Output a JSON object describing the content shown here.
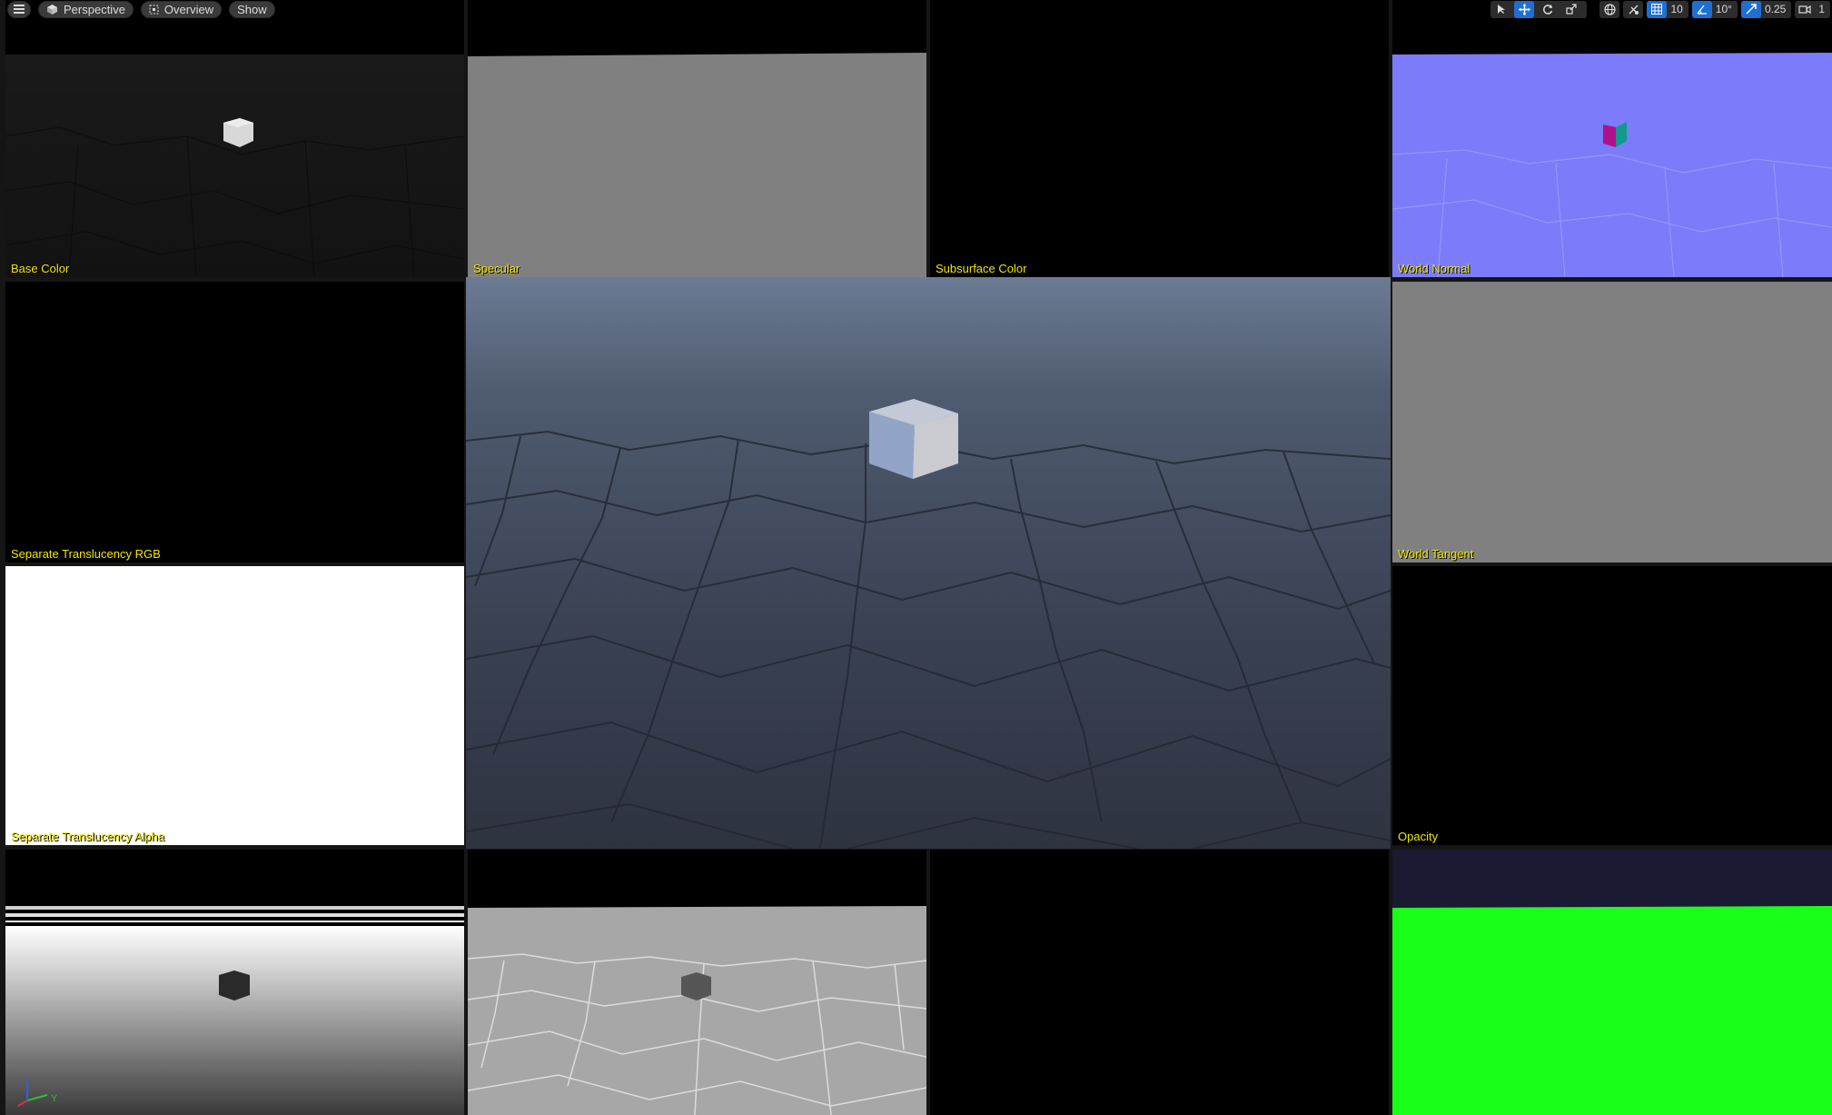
{
  "toolbar": {
    "menu_icon": "hamburger-icon",
    "perspective_label": "Perspective",
    "overview_label": "Overview",
    "show_label": "Show",
    "grid_snap_value": "10",
    "rotation_snap_value": "10°",
    "scale_snap_value": "0.25",
    "camera_speed_value": "1"
  },
  "panes": {
    "base_color": "Base Color",
    "specular": "Specular",
    "subsurface_color": "Subsurface Color",
    "world_normal": "World Normal",
    "separate_translucency_rgb": "Separate Translucency RGB",
    "world_tangent": "World Tangent",
    "separate_translucency_alpha": "Separate Translucency Alpha",
    "opacity": "Opacity"
  },
  "gizmo": {
    "y_label": "Y"
  },
  "colors": {
    "label_yellow": "#f0e600",
    "accent_blue": "#1f6fd1",
    "normal_blue": "#8080ff",
    "green": "#19ff19"
  }
}
